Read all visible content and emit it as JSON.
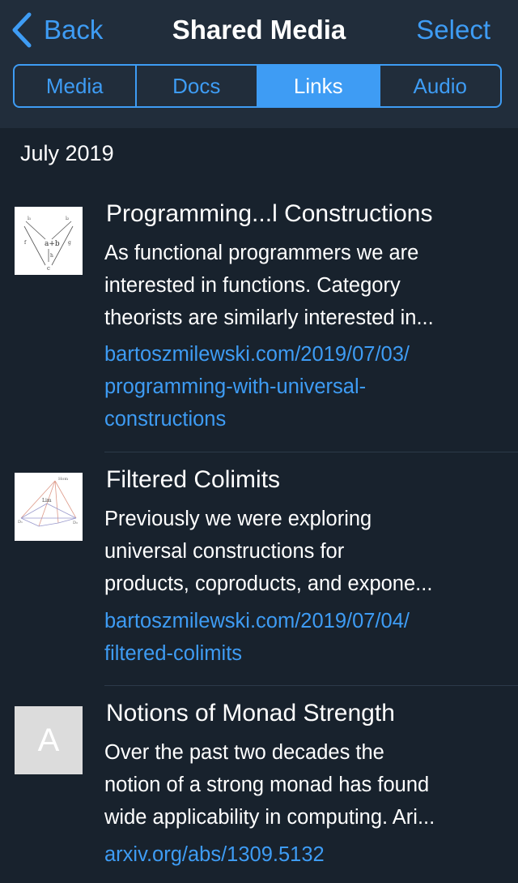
{
  "nav": {
    "back_label": "Back",
    "title": "Shared Media",
    "select_label": "Select"
  },
  "tabs": [
    {
      "label": "Media",
      "active": false
    },
    {
      "label": "Docs",
      "active": false
    },
    {
      "label": "Links",
      "active": true
    },
    {
      "label": "Audio",
      "active": false
    }
  ],
  "section_header": "July 2019",
  "links": [
    {
      "title": "Programming...l Constructions",
      "description_lines": [
        "As functional programmers we are",
        "interested in functions. Category",
        "theorists are similarly interested in..."
      ],
      "url_lines": [
        "bartoszmilewski.com/2019/07/03/",
        "programming-with-universal-",
        "constructions"
      ]
    },
    {
      "title": "Filtered Colimits",
      "description_lines": [
        "Previously we were exploring",
        "universal constructions for",
        "products, coproducts, and expone..."
      ],
      "url_lines": [
        "bartoszmilewski.com/2019/07/04/",
        "filtered-colimits"
      ]
    },
    {
      "title": "Notions of Monad Strength",
      "thumb_letter": "A",
      "description_lines": [
        "Over the past two decades the",
        "notion of a strong monad has found",
        "wide applicability in computing. Ari..."
      ],
      "url_lines": [
        "arxiv.org/abs/1309.5132"
      ]
    }
  ],
  "colors": {
    "background": "#18222d",
    "header": "#212d3b",
    "accent": "#3e9cf4",
    "separator": "#2c3a49"
  }
}
